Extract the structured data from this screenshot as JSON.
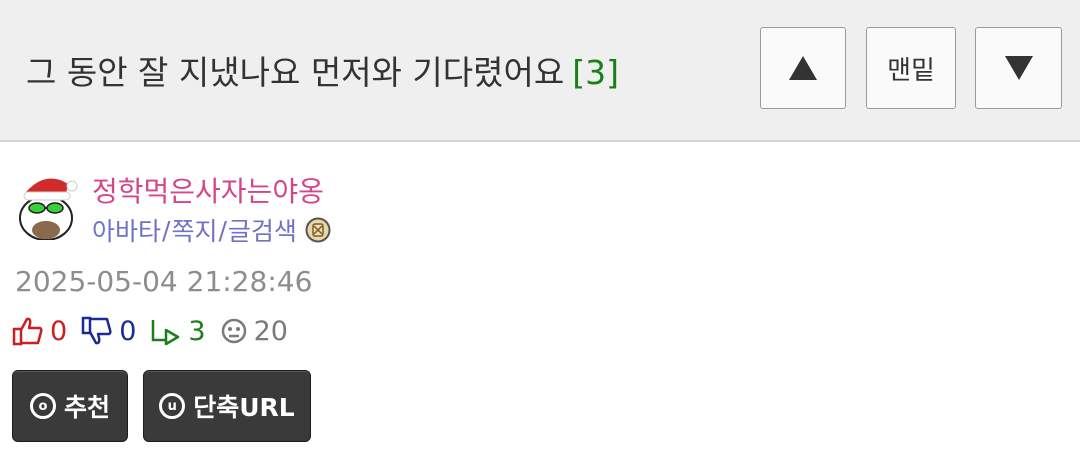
{
  "header": {
    "title": "그 동안 잘 지냈나요 먼저와 기다렸어요",
    "comment_count": "[3]",
    "up_icon": "triangle-up-icon",
    "bottom_label": "맨밑",
    "down_icon": "triangle-down-icon"
  },
  "author": {
    "nickname": "정학먹은사자는야옹",
    "links": [
      "아바타",
      "쪽지",
      "글검색"
    ],
    "separator": "/",
    "avatar_icon": "santa-hat-avatar-icon",
    "level_icon": "level-badge-icon"
  },
  "post": {
    "datetime": "2025-05-04 21:28:46"
  },
  "stats": {
    "likes": "0",
    "dislikes": "0",
    "replies": "3",
    "views": "20"
  },
  "actions": {
    "recommend_label": "추천",
    "recommend_icon_letter": "o",
    "shorturl_label": "단축URL",
    "shorturl_icon_letter": "u"
  },
  "colors": {
    "header_bg": "#efefef",
    "nickname": "#d4458a",
    "links": "#6f72c6",
    "like": "#cc1f1f",
    "dislike": "#1a2a9a",
    "reply": "#1a7f1a",
    "button_bg": "#3a3a3a"
  }
}
